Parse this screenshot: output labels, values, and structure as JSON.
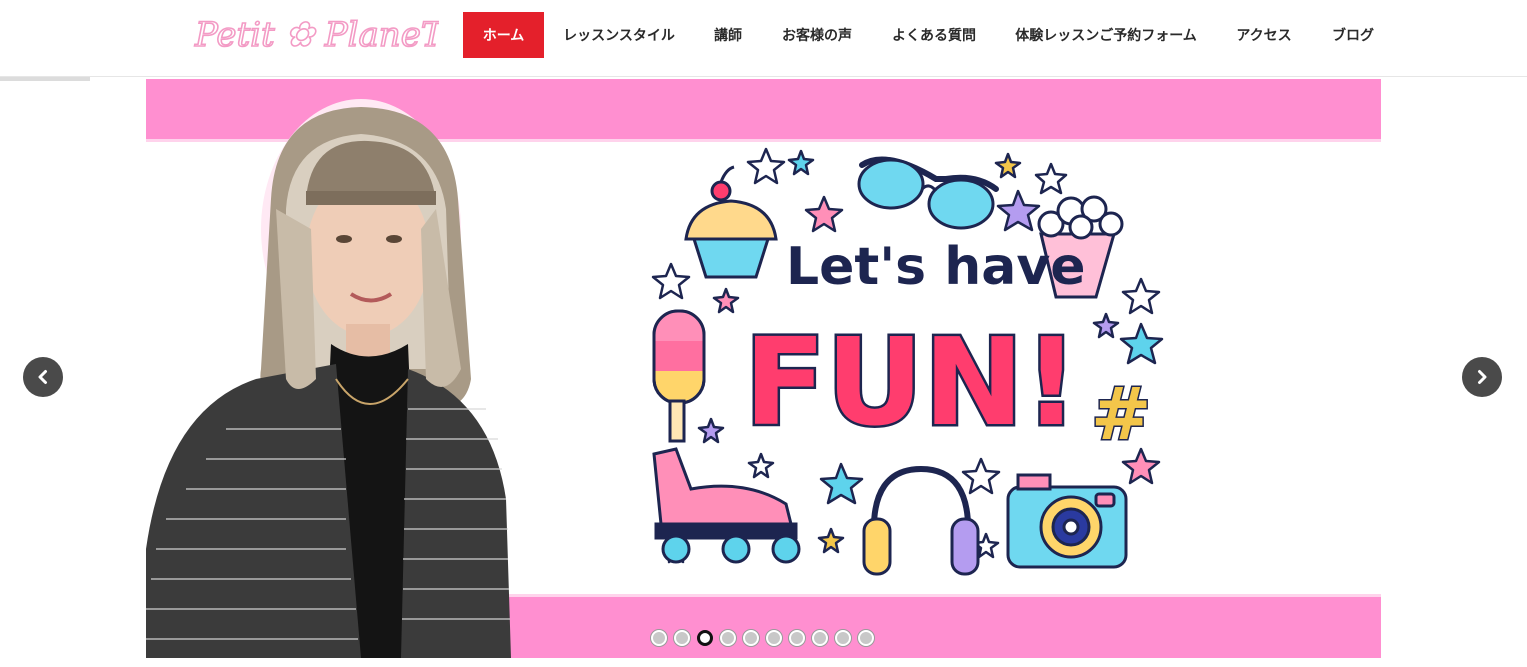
{
  "site": {
    "logo_text": "Petit ✿ PlaneT"
  },
  "nav": {
    "items": [
      {
        "label": "ホーム",
        "active": true
      },
      {
        "label": "レッスンスタイル",
        "active": false
      },
      {
        "label": "講師",
        "active": false
      },
      {
        "label": "お客様の声",
        "active": false
      },
      {
        "label": "よくある質問",
        "active": false
      },
      {
        "label": "体験レッスンご予約フォーム",
        "active": false
      },
      {
        "label": "アクセス",
        "active": false
      },
      {
        "label": "ブログ",
        "active": false
      }
    ]
  },
  "slider": {
    "slide_text": {
      "line1": "Let's have",
      "line2": "FUN!",
      "hashtag": "#"
    },
    "dot_count": 10,
    "active_dot_index": 2,
    "colors": {
      "banner_pink": "#ff8fd0",
      "fun_pink": "#ff3d6e",
      "text_navy": "#1d2550",
      "arrow_bg": "#4a4a4a"
    }
  },
  "icons": {
    "prev": "chevron-left-icon",
    "next": "chevron-right-icon"
  }
}
